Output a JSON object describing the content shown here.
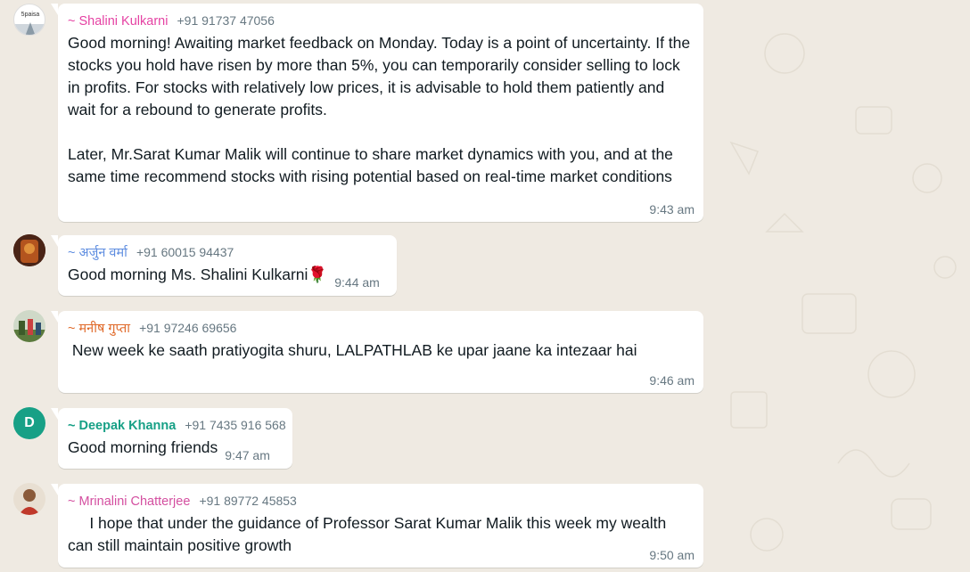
{
  "colors": {
    "background": "#efeae2",
    "bubble": "#ffffff",
    "sender_shalini": "#e542a3",
    "sender_arjun": "#5e8de0",
    "sender_manish": "#e06a2a",
    "sender_deepak": "#17a086",
    "sender_mrinalini": "#d44fa0"
  },
  "messages": [
    {
      "avatar": "avatar-5paisa-icon",
      "avatar_text": "5paisa",
      "sender": "~ Shalini Kulkarni",
      "phone": "+91 91737 47056",
      "text": "Good morning! Awaiting market feedback on Monday. Today is a point of uncertainty. If the stocks you hold have risen by more than 5%, you can temporarily consider selling to lock in profits. For stocks with relatively low prices, it is advisable to hold them patiently and wait for a rebound to generate profits.\n\nLater, Mr.Sarat Kumar Malik will continue to share market dynamics with you, and at the same time recommend stocks with rising potential based on real-time market conditions",
      "time": "9:43 am"
    },
    {
      "avatar": "avatar-photo-icon",
      "sender": "~ अर्जुन वर्मा",
      "phone": "+91 60015 94437",
      "text": "Good morning Ms. Shalini Kulkarni🌹",
      "time": "9:44 am"
    },
    {
      "avatar": "avatar-photo-icon",
      "sender": "~ मनीष गुप्ता",
      "phone": "+91 97246 69656",
      "text": " New week ke saath pratiyogita shuru, LALPATHLAB ke upar jaane ka intezaar hai",
      "time": "9:46 am"
    },
    {
      "avatar_letter": "D",
      "sender": "~ Deepak Khanna",
      "phone": "+91 7435 916 568",
      "text": "Good morning friends",
      "time": "9:47 am"
    },
    {
      "avatar": "avatar-photo-icon",
      "sender": "~ Mrinalini Chatterjee",
      "phone": "+91 89772 45853",
      "text": "     I hope that under the guidance of Professor Sarat Kumar Malik this week my wealth can still maintain positive growth",
      "time": "9:50 am"
    }
  ]
}
